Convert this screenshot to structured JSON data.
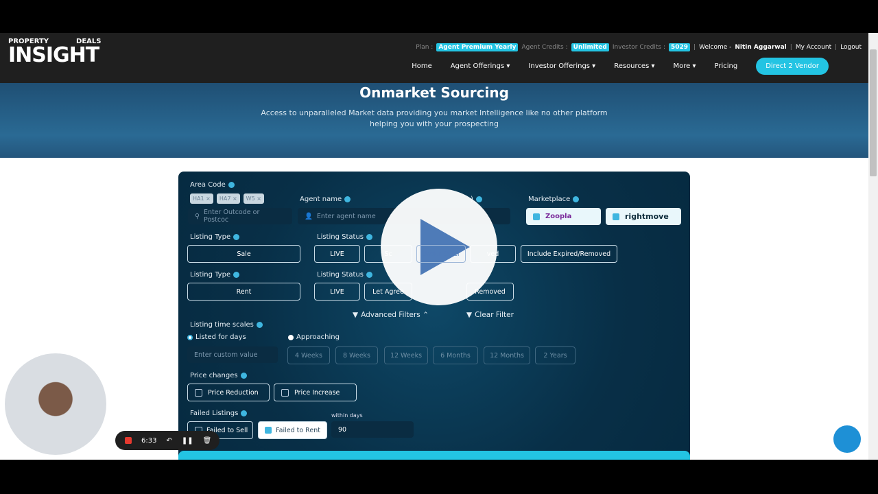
{
  "header": {
    "logo_top_left": "PROPERTY",
    "logo_top_right": "DEALS",
    "logo_main": "INSIGHT",
    "plan_label": "Plan :",
    "plan_value": "Agent Premium Yearly",
    "agent_credits_label": "Agent Credits :",
    "agent_credits_value": "Unlimited",
    "investor_credits_label": "Investor Credits :",
    "investor_credits_value": "5029",
    "welcome": "Welcome - ",
    "user": "Nitin Aggarwal",
    "my_account": "My Account",
    "logout": "Logout",
    "nav": [
      "Home",
      "Agent Offerings ▾",
      "Investor Offerings ▾",
      "Resources ▾",
      "More ▾",
      "Pricing"
    ],
    "cta": "Direct 2 Vendor"
  },
  "hero": {
    "title": "Onmarket Sourcing",
    "subtitle_1": "Access to unparalleled Market data providing you market Intelligence like no other platform",
    "subtitle_2": "helping you with your prospecting"
  },
  "form": {
    "area_code_label": "Area Code",
    "area_chips": [
      "HA1 ×",
      "HA7 ×",
      "W5 ×"
    ],
    "area_placeholder": "Enter Outcode or Postcoc",
    "agent_label": "Agent name",
    "agent_placeholder": "Enter agent name",
    "hidden_label": ")",
    "marketplace_label": "Marketplace",
    "marketplaces": [
      "Zoopla",
      "rightmove"
    ],
    "listing_type_label": "Listing Type",
    "listing_status_label": "Listing Status",
    "sale": "Sale",
    "rent": "Rent",
    "sale_status": [
      "LIVE",
      "Sc",
      "Under Offer",
      "ved",
      "Include Expired/Removed"
    ],
    "rent_status": [
      "LIVE",
      "Let Agree",
      "Removed"
    ],
    "advanced_filters": "Advanced Filters ⌃",
    "clear_filter": "Clear Filter",
    "time_label": "Listing time scales",
    "listed_for_days": "Listed for days",
    "approaching": "Approaching",
    "custom_placeholder": "Enter custom value",
    "time_options": [
      "4 Weeks",
      "8 Weeks",
      "12 Weeks",
      "6 Months",
      "12 Months",
      "2 Years"
    ],
    "price_label": "Price changes",
    "price_reduction": "Price Reduction",
    "price_increase": "Price Increase",
    "failed_label": "Failed Listings",
    "failed_sell": "Failed to Sell",
    "failed_rent": "Failed to Rent",
    "within_days_label": "within days",
    "within_days_value": "90"
  },
  "recorder": {
    "time": "6:33"
  },
  "colors": {
    "accent": "#23c4e3",
    "card": "#082f47"
  }
}
